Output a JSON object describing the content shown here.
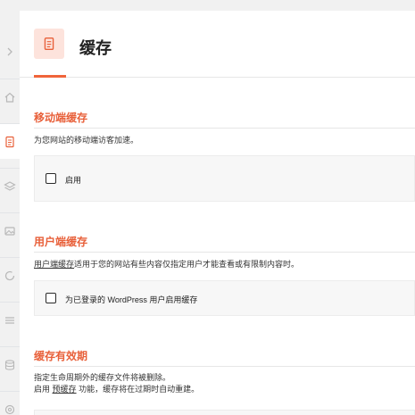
{
  "header": {
    "title": "缓存",
    "icon": "document-icon"
  },
  "sidebar": {
    "items": [
      {
        "icon": "chevron-icon",
        "active": false
      },
      {
        "icon": "home-icon",
        "active": false
      },
      {
        "icon": "document-icon",
        "active": true
      },
      {
        "icon": "layers-icon",
        "active": false
      },
      {
        "icon": "image-icon",
        "active": false
      },
      {
        "icon": "refresh-icon",
        "active": false
      },
      {
        "icon": "menu-icon",
        "active": false
      },
      {
        "icon": "database-icon",
        "active": false
      },
      {
        "icon": "settings-icon",
        "active": false
      }
    ]
  },
  "sections": {
    "mobile": {
      "title": "移动端缓存",
      "description": "为您网站的移动端访客加速。",
      "option_label": "启用",
      "checked": false
    },
    "user": {
      "title": "用户端缓存",
      "description_link": "用户端缓存",
      "description_rest": "适用于您的网站有些内容仅指定用户才能查看或有限制内容时。",
      "option_label": "为已登录的 WordPress 用户启用缓存",
      "checked": false
    },
    "lifespan": {
      "title": "缓存有效期",
      "description_line1": "指定生命周期外的缓存文件将被删除。",
      "description_line2_prefix": "启用",
      "description_line2_link": "预缓存",
      "description_line2_suffix": "功能，缓存将在过期时自动重建。"
    }
  },
  "colors": {
    "accent": "#e8603a",
    "accent_light": "#fde3dc"
  }
}
